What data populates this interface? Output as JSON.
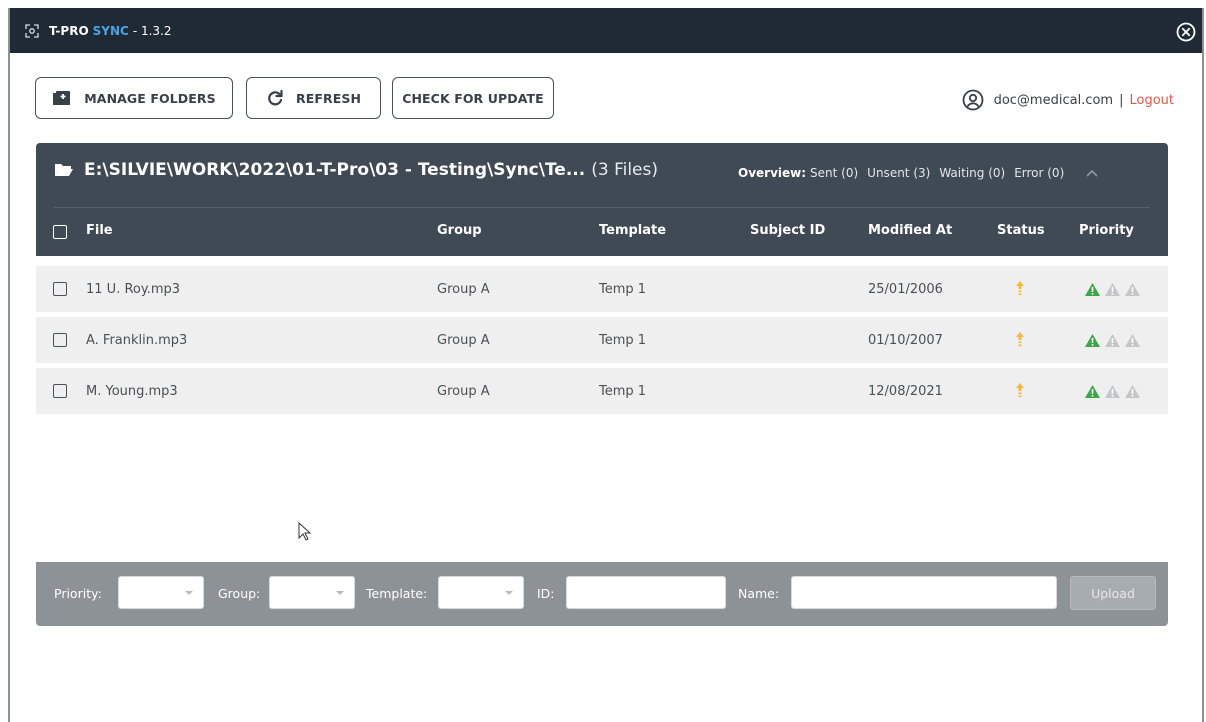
{
  "window": {
    "title_strong": "T-PRO",
    "title_sync": "SYNC",
    "title_version": "- 1.3.2"
  },
  "toolbar": {
    "manage_folders": "MANAGE FOLDERS",
    "refresh": "REFRESH",
    "check_update": "CHECK FOR UPDATE"
  },
  "user": {
    "email": "doc@medical.com",
    "separator": "|",
    "logout": "Logout"
  },
  "folder": {
    "path": "E:\\SILVIE\\WORK\\2022\\01-T-Pro\\03 - Testing\\Sync\\Te...",
    "file_count": "(3 Files)",
    "overview_label": "Overview:",
    "overview_sent": "Sent (0)",
    "overview_unsent": "Unsent (3)",
    "overview_waiting": "Waiting (0)",
    "overview_error": "Error (0)"
  },
  "table": {
    "columns": [
      "File",
      "Group",
      "Template",
      "Subject ID",
      "Modified At",
      "Status",
      "Priority"
    ],
    "rows": [
      {
        "file": "11 U. Roy.mp3",
        "group": "Group A",
        "template": "Temp 1",
        "subject_id": "",
        "modified": "25/01/2006",
        "priority_level": 1
      },
      {
        "file": "A. Franklin.mp3",
        "group": "Group A",
        "template": "Temp 1",
        "subject_id": "",
        "modified": "01/10/2007",
        "priority_level": 1
      },
      {
        "file": "M. Young.mp3",
        "group": "Group A",
        "template": "Temp 1",
        "subject_id": "",
        "modified": "12/08/2021",
        "priority_level": 1
      }
    ]
  },
  "footer": {
    "priority_label": "Priority:",
    "group_label": "Group:",
    "template_label": "Template:",
    "id_label": "ID:",
    "name_label": "Name:",
    "upload": "Upload",
    "priority_value": "",
    "group_value": "",
    "template_value": "",
    "id_value": "",
    "name_value": ""
  },
  "colors": {
    "titlebar": "#1f2a35",
    "accent_sync": "#4aa3e8",
    "panel_header": "#3f4a55",
    "row_bg": "#efefef",
    "status_upload": "#f5b942",
    "priority_active": "#3aa845",
    "priority_inactive": "#c4c7ca",
    "logout": "#e2574c",
    "footer": "#8d9297"
  },
  "icons": {
    "app": "sync-app-icon",
    "close": "close-circle-icon",
    "manage": "folder-plus-icon",
    "refresh": "refresh-icon",
    "user": "user-circle-icon",
    "folder": "folder-open-icon",
    "collapse": "chevron-up-icon",
    "status": "upload-arrow-icon",
    "priority": "warning-triangle-icon"
  }
}
